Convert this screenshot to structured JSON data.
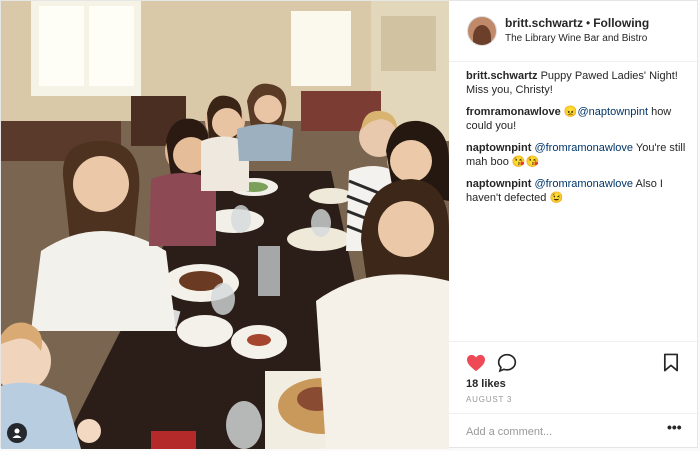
{
  "header": {
    "username": "britt.schwartz",
    "separator": "•",
    "follow_status": "Following",
    "location": "The Library Wine Bar and Bistro"
  },
  "comments": [
    {
      "user": "britt.schwartz",
      "parts": [
        {
          "t": " Puppy Pawed Ladies' Night! Miss you, Christy!",
          "m": false
        }
      ]
    },
    {
      "user": "fromramonawlove",
      "parts": [
        {
          "t": " 😠",
          "m": false
        },
        {
          "t": "@naptownpint",
          "m": true
        },
        {
          "t": " how could you!",
          "m": false
        }
      ]
    },
    {
      "user": "naptownpint",
      "parts": [
        {
          "t": " ",
          "m": false
        },
        {
          "t": "@fromramonawlove",
          "m": true
        },
        {
          "t": " You're still mah boo 😘😘",
          "m": false
        }
      ]
    },
    {
      "user": "naptownpint",
      "parts": [
        {
          "t": " ",
          "m": false
        },
        {
          "t": "@fromramonawlove",
          "m": true
        },
        {
          "t": " Also I haven't defected 😉",
          "m": false
        }
      ]
    }
  ],
  "actions": {
    "like_icon": "heart-filled-icon",
    "comment_icon": "comment-bubble-icon",
    "save_icon": "bookmark-icon",
    "like_color": "#ed4956"
  },
  "likes": "18 likes",
  "date": "AUGUST 3",
  "add_comment": {
    "placeholder": "Add a comment...",
    "more": "•••"
  },
  "photo": {
    "tag_icon": "user-tag-icon"
  }
}
